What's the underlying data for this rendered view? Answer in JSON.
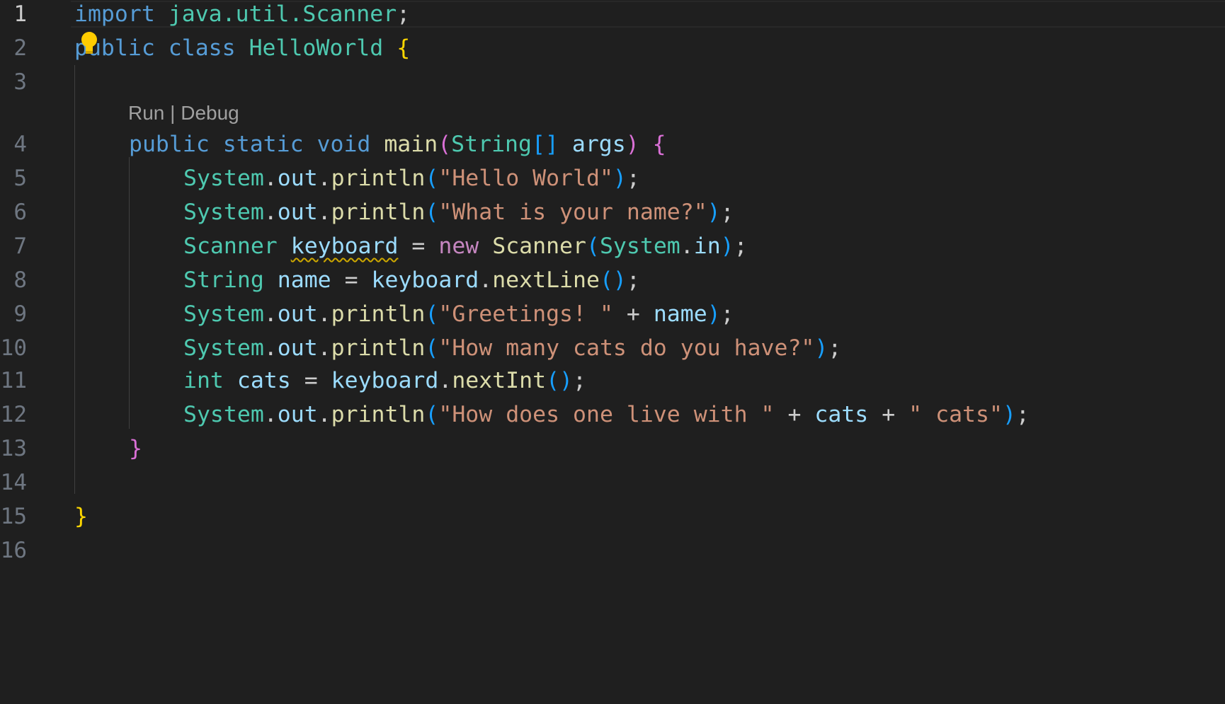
{
  "editor": {
    "language": "java",
    "active_line": "1",
    "codelens": {
      "run": "Run",
      "separator": " | ",
      "debug": "Debug"
    },
    "line_numbers": [
      "1",
      "2",
      "3",
      "4",
      "5",
      "6",
      "7",
      "8",
      "9",
      "10",
      "11",
      "12",
      "13",
      "14",
      "15",
      "16"
    ],
    "lines": [
      [
        {
          "t": "import",
          "c": "kw"
        },
        {
          "t": " java.util.Scanner",
          "c": "ty"
        },
        {
          "t": ";",
          "c": "plain"
        }
      ],
      [
        {
          "t": "public",
          "c": "kw"
        },
        {
          "t": " class ",
          "c": "kw"
        },
        {
          "t": "HelloWorld",
          "c": "ty"
        },
        {
          "t": " ",
          "c": "plain"
        },
        {
          "t": "{",
          "c": "p1"
        }
      ],
      [],
      [
        {
          "t": "public",
          "c": "kw"
        },
        {
          "t": " static ",
          "c": "kw"
        },
        {
          "t": "void",
          "c": "kw"
        },
        {
          "t": " ",
          "c": "plain"
        },
        {
          "t": "main",
          "c": "fn"
        },
        {
          "t": "(",
          "c": "p2"
        },
        {
          "t": "String",
          "c": "ty"
        },
        {
          "t": "[]",
          "c": "p3"
        },
        {
          "t": " ",
          "c": "plain"
        },
        {
          "t": "args",
          "c": "var"
        },
        {
          "t": ")",
          "c": "p2"
        },
        {
          "t": " ",
          "c": "plain"
        },
        {
          "t": "{",
          "c": "p2"
        }
      ],
      [
        {
          "t": "System",
          "c": "ty"
        },
        {
          "t": ".",
          "c": "plain"
        },
        {
          "t": "out",
          "c": "var"
        },
        {
          "t": ".",
          "c": "plain"
        },
        {
          "t": "println",
          "c": "fn"
        },
        {
          "t": "(",
          "c": "p3"
        },
        {
          "t": "\"Hello World\"",
          "c": "str"
        },
        {
          "t": ")",
          "c": "p3"
        },
        {
          "t": ";",
          "c": "plain"
        }
      ],
      [
        {
          "t": "System",
          "c": "ty"
        },
        {
          "t": ".",
          "c": "plain"
        },
        {
          "t": "out",
          "c": "var"
        },
        {
          "t": ".",
          "c": "plain"
        },
        {
          "t": "println",
          "c": "fn"
        },
        {
          "t": "(",
          "c": "p3"
        },
        {
          "t": "\"What is your name?\"",
          "c": "str"
        },
        {
          "t": ")",
          "c": "p3"
        },
        {
          "t": ";",
          "c": "plain"
        }
      ],
      [
        {
          "t": "Scanner",
          "c": "ty"
        },
        {
          "t": " ",
          "c": "plain"
        },
        {
          "t": "keyboard",
          "c": "var squiggle"
        },
        {
          "t": " = ",
          "c": "plain"
        },
        {
          "t": "new",
          "c": "kw2"
        },
        {
          "t": " ",
          "c": "plain"
        },
        {
          "t": "Scanner",
          "c": "fn"
        },
        {
          "t": "(",
          "c": "p3"
        },
        {
          "t": "System",
          "c": "ty"
        },
        {
          "t": ".",
          "c": "plain"
        },
        {
          "t": "in",
          "c": "var"
        },
        {
          "t": ")",
          "c": "p3"
        },
        {
          "t": ";",
          "c": "plain"
        }
      ],
      [
        {
          "t": "String",
          "c": "ty"
        },
        {
          "t": " ",
          "c": "plain"
        },
        {
          "t": "name",
          "c": "var"
        },
        {
          "t": " = ",
          "c": "plain"
        },
        {
          "t": "keyboard",
          "c": "var"
        },
        {
          "t": ".",
          "c": "plain"
        },
        {
          "t": "nextLine",
          "c": "fn"
        },
        {
          "t": "()",
          "c": "p3"
        },
        {
          "t": ";",
          "c": "plain"
        }
      ],
      [
        {
          "t": "System",
          "c": "ty"
        },
        {
          "t": ".",
          "c": "plain"
        },
        {
          "t": "out",
          "c": "var"
        },
        {
          "t": ".",
          "c": "plain"
        },
        {
          "t": "println",
          "c": "fn"
        },
        {
          "t": "(",
          "c": "p3"
        },
        {
          "t": "\"Greetings! \"",
          "c": "str"
        },
        {
          "t": " + ",
          "c": "plain"
        },
        {
          "t": "name",
          "c": "var"
        },
        {
          "t": ")",
          "c": "p3"
        },
        {
          "t": ";",
          "c": "plain"
        }
      ],
      [
        {
          "t": "System",
          "c": "ty"
        },
        {
          "t": ".",
          "c": "plain"
        },
        {
          "t": "out",
          "c": "var"
        },
        {
          "t": ".",
          "c": "plain"
        },
        {
          "t": "println",
          "c": "fn"
        },
        {
          "t": "(",
          "c": "p3"
        },
        {
          "t": "\"How many cats do you have?\"",
          "c": "str"
        },
        {
          "t": ")",
          "c": "p3"
        },
        {
          "t": ";",
          "c": "plain"
        }
      ],
      [
        {
          "t": "int",
          "c": "ty"
        },
        {
          "t": " ",
          "c": "plain"
        },
        {
          "t": "cats",
          "c": "var"
        },
        {
          "t": " = ",
          "c": "plain"
        },
        {
          "t": "keyboard",
          "c": "var"
        },
        {
          "t": ".",
          "c": "plain"
        },
        {
          "t": "nextInt",
          "c": "fn"
        },
        {
          "t": "()",
          "c": "p3"
        },
        {
          "t": ";",
          "c": "plain"
        }
      ],
      [
        {
          "t": "System",
          "c": "ty"
        },
        {
          "t": ".",
          "c": "plain"
        },
        {
          "t": "out",
          "c": "var"
        },
        {
          "t": ".",
          "c": "plain"
        },
        {
          "t": "println",
          "c": "fn"
        },
        {
          "t": "(",
          "c": "p3"
        },
        {
          "t": "\"How does one live with \"",
          "c": "str"
        },
        {
          "t": " + ",
          "c": "plain"
        },
        {
          "t": "cats",
          "c": "var"
        },
        {
          "t": " + ",
          "c": "plain"
        },
        {
          "t": "\" cats\"",
          "c": "str"
        },
        {
          "t": ")",
          "c": "p3"
        },
        {
          "t": ";",
          "c": "plain"
        }
      ],
      [
        {
          "t": "}",
          "c": "p2"
        }
      ],
      [],
      [
        {
          "t": "}",
          "c": "p1"
        }
      ],
      []
    ]
  },
  "colors": {
    "background": "#1f1f1f",
    "keyword": "#569cd6",
    "type": "#4ec9b0",
    "function": "#dcdcaa",
    "string": "#ce9178",
    "variable": "#9cdcfe",
    "warning": "#cca700",
    "lightbulb": "#ffcc00"
  },
  "icons": {
    "code_action": "lightbulb-icon"
  }
}
